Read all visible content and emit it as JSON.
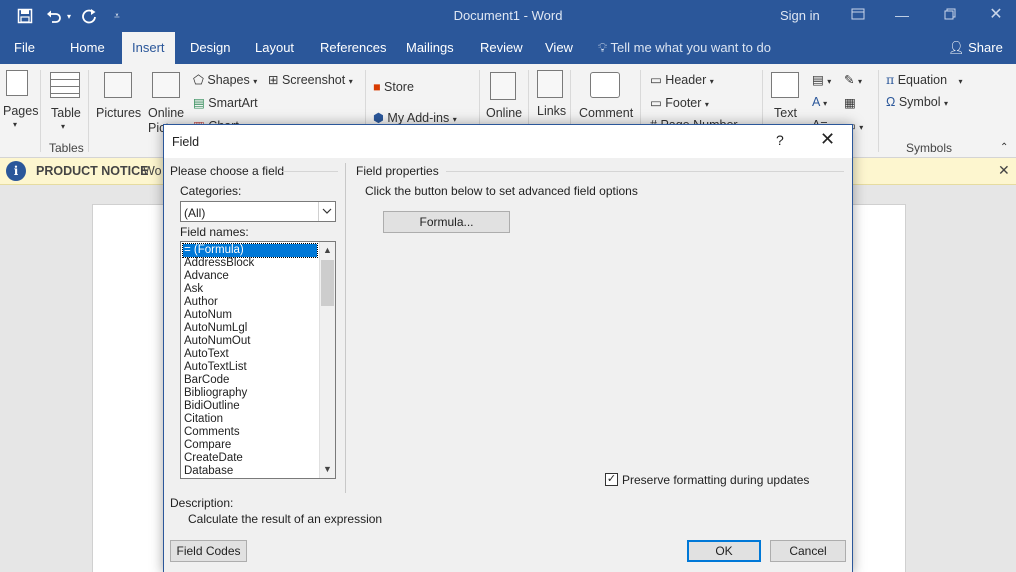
{
  "window": {
    "document_title": "Document1 - Word",
    "sign_in": "Sign in"
  },
  "quick_access": {
    "save_icon": "save-icon",
    "undo_icon": "undo-icon",
    "redo_icon": "redo-icon",
    "customize_icon": "customize-icon"
  },
  "tabs": [
    "File",
    "Home",
    "Insert",
    "Design",
    "Layout",
    "References",
    "Mailings",
    "Review",
    "View"
  ],
  "active_tab": "Insert",
  "tell_me": "Tell me what you want to do",
  "share": "Share",
  "ribbon": {
    "pages": "Pages",
    "table": "Table",
    "tables_group": "Tables",
    "pictures": "Pictures",
    "online_pictures": "Online Pict",
    "shapes": "Shapes",
    "smartart": "SmartArt",
    "chart": "Chart",
    "screenshot": "Screenshot",
    "store": "Store",
    "my_addins": "My Add-ins",
    "online_video": "Online",
    "links": "Links",
    "comment": "Comment",
    "header": "Header",
    "footer": "Footer",
    "page_number": "Page Number",
    "text_box": "Text",
    "equation": "Equation",
    "symbol": "Symbol",
    "symbols_group": "Symbols"
  },
  "notice": {
    "label": "PRODUCT NOTICE",
    "message": "Wo"
  },
  "dialog": {
    "title": "Field",
    "help": "?",
    "left_header": "Please choose a field",
    "categories_label": "Categories:",
    "categories_value": "(All)",
    "field_names_label": "Field names:",
    "field_names": [
      "= (Formula)",
      "AddressBlock",
      "Advance",
      "Ask",
      "Author",
      "AutoNum",
      "AutoNumLgl",
      "AutoNumOut",
      "AutoText",
      "AutoTextList",
      "BarCode",
      "Bibliography",
      "BidiOutline",
      "Citation",
      "Comments",
      "Compare",
      "CreateDate",
      "Database"
    ],
    "selected_index": 0,
    "right_header": "Field properties",
    "advanced_hint": "Click the button below to set advanced field options",
    "formula_button": "Formula...",
    "preserve_formatting": "Preserve formatting during updates",
    "preserve_checked": true,
    "description_label": "Description:",
    "description_text": "Calculate the result of an expression",
    "field_codes_button": "Field Codes",
    "ok_button": "OK",
    "cancel_button": "Cancel"
  }
}
